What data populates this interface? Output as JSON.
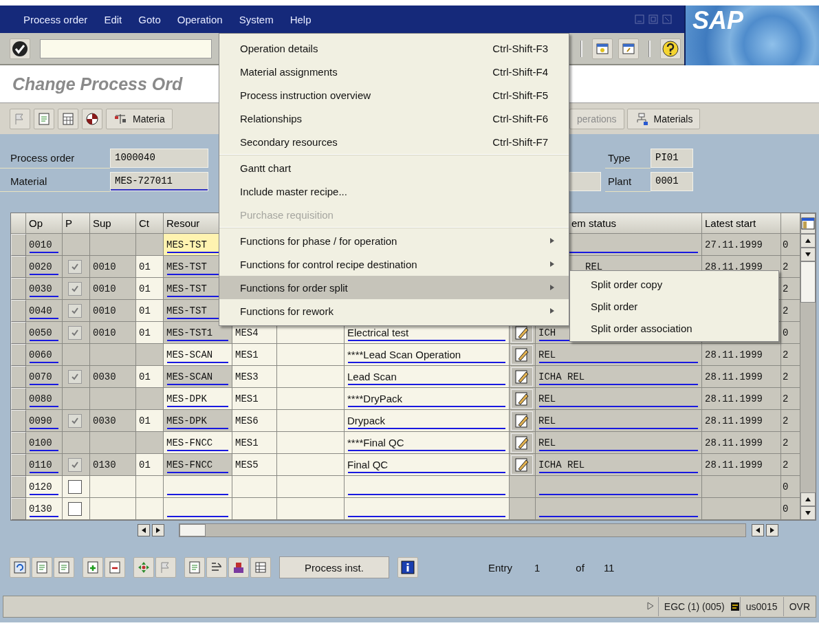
{
  "menu_bar": [
    {
      "label": "Process order"
    },
    {
      "label": "Edit"
    },
    {
      "label": "Goto"
    },
    {
      "label": "Operation"
    },
    {
      "label": "System"
    },
    {
      "label": "Help"
    }
  ],
  "logo": "SAP",
  "title": "Change Process Ord",
  "app_toolbar": [
    {
      "label": "Materia",
      "disabled": false
    },
    {
      "label": "perations",
      "disabled": true
    },
    {
      "label": "Materials",
      "disabled": false
    }
  ],
  "header": {
    "left": [
      {
        "label": "Process order",
        "value": "1000040"
      },
      {
        "label": "Material",
        "value": "MES-727011"
      }
    ],
    "right": [
      {
        "label": "Type",
        "value": "PI01"
      },
      {
        "label": "Plant",
        "value": "0001"
      }
    ]
  },
  "table": {
    "columns": [
      {
        "label": "Op"
      },
      {
        "label": "P"
      },
      {
        "label": "Sup"
      },
      {
        "label": "Ct"
      },
      {
        "label": "Resour"
      },
      {
        "label": "em status"
      },
      {
        "label": "Latest start"
      }
    ],
    "rows": [
      {
        "op": "0010",
        "locked": true,
        "focused": true,
        "resource": "MES-TST",
        "latest_start": "27.11.1999",
        "column_12": "0"
      },
      {
        "op": "0020",
        "locked": true,
        "focused": false,
        "checked": true,
        "disabled": true,
        "sup": "0010",
        "ct": "01",
        "resource": "MES-TST",
        "status": "REL",
        "latest_start": "28.11.1999",
        "column_12": "2"
      },
      {
        "op": "0030",
        "locked": true,
        "focused": false,
        "checked": true,
        "disabled": true,
        "sup": "0010",
        "ct": "01",
        "resource": "MES-TST",
        "column_12": "2"
      },
      {
        "op": "0040",
        "locked": true,
        "focused": false,
        "checked": true,
        "disabled": true,
        "sup": "0010",
        "ct": "01",
        "resource": "MES-TST",
        "column_12": "2"
      },
      {
        "op": "0050",
        "locked": true,
        "focused": false,
        "checked": true,
        "disabled": true,
        "sup": "0010",
        "ct": "01",
        "resource": "MES-TST1",
        "column_6": "MES4",
        "column_8": "Electrical test",
        "detail": true,
        "status": "ICH",
        "column_12": "0"
      },
      {
        "op": "0060",
        "locked": true,
        "focused": false,
        "resource": "MES-SCAN",
        "column_6": "MES1",
        "column_8": "****Lead Scan Operation",
        "detail": true,
        "status": "REL",
        "latest_start": "28.11.1999",
        "column_12": "2"
      },
      {
        "op": "0070",
        "locked": true,
        "focused": false,
        "checked": true,
        "disabled": true,
        "sup": "0030",
        "ct": "01",
        "resource": "MES-SCAN",
        "column_6": "MES3",
        "column_8": "Lead Scan",
        "detail": true,
        "status": "ICHA REL",
        "latest_start": "28.11.1999",
        "column_12": "2"
      },
      {
        "op": "0080",
        "locked": true,
        "focused": false,
        "resource": "MES-DPK",
        "column_6": "MES1",
        "column_8": "****DryPack",
        "detail": true,
        "status": "REL",
        "latest_start": "28.11.1999",
        "column_12": "2"
      },
      {
        "op": "0090",
        "locked": true,
        "focused": false,
        "checked": true,
        "disabled": true,
        "sup": "0030",
        "ct": "01",
        "resource": "MES-DPK",
        "column_6": "MES6",
        "column_8": "Drypack",
        "detail": true,
        "status": "REL",
        "latest_start": "28.11.1999",
        "column_12": "2"
      },
      {
        "op": "0100",
        "locked": true,
        "focused": false,
        "resource": "MES-FNCC",
        "column_6": "MES1",
        "column_8": "****Final QC",
        "detail": true,
        "status": "REL",
        "latest_start": "28.11.1999",
        "column_12": "2"
      },
      {
        "op": "0110",
        "locked": true,
        "focused": false,
        "checked": true,
        "disabled": true,
        "sup": "0130",
        "ct": "01",
        "resource": "MES-FNCC",
        "column_6": "MES5",
        "column_8": "Final QC",
        "detail": true,
        "status": "ICHA REL",
        "latest_start": "28.11.1999",
        "column_12": "2"
      },
      {
        "op": "0120",
        "locked": false,
        "focused": false,
        "checked": false,
        "disabled": false,
        "detail": false,
        "column_12": "0"
      },
      {
        "op": "0130",
        "locked": false,
        "focused": false,
        "checked": false,
        "disabled": false,
        "detail": false,
        "column_12": "0"
      }
    ]
  },
  "bottom_toolbar": {
    "button": "Process inst.",
    "entry_label": "Entry",
    "entry_current": "1",
    "entry_of": "of",
    "entry_total": "11"
  },
  "status_bar": {
    "system": "EGC (1) (005)",
    "client": "us0015",
    "mode": "OVR"
  },
  "operation_menu": {
    "items": [
      {
        "kind": "item",
        "label": "Operation details",
        "shortcut": "Ctrl-Shift-F3",
        "disabled": false,
        "selected": false
      },
      {
        "kind": "item",
        "label": "Material assignments",
        "shortcut": "Ctrl-Shift-F4",
        "disabled": false,
        "selected": false
      },
      {
        "kind": "item",
        "label": "Process instruction overview",
        "shortcut": "Ctrl-Shift-F5",
        "disabled": false,
        "selected": false
      },
      {
        "kind": "item",
        "label": "Relationships",
        "shortcut": "Ctrl-Shift-F6",
        "disabled": false,
        "selected": false
      },
      {
        "kind": "item",
        "label": "Secondary resources",
        "shortcut": "Ctrl-Shift-F7",
        "disabled": false,
        "selected": false
      },
      {
        "kind": "separator"
      },
      {
        "kind": "item",
        "label": "Gantt chart",
        "disabled": false,
        "selected": false
      },
      {
        "kind": "item",
        "label": "Include master recipe...",
        "disabled": false,
        "selected": false
      },
      {
        "kind": "item",
        "label": "Purchase requisition",
        "disabled": true,
        "selected": false
      },
      {
        "kind": "separator"
      },
      {
        "kind": "submenu",
        "label": "Functions for phase / for operation",
        "disabled": false,
        "selected": false
      },
      {
        "kind": "submenu",
        "label": "Functions for control recipe destination",
        "disabled": false,
        "selected": false
      },
      {
        "kind": "submenu",
        "label": "Functions for order split",
        "disabled": false,
        "selected": true
      },
      {
        "kind": "submenu",
        "label": "Functions for rework",
        "disabled": false,
        "selected": false
      }
    ],
    "submenu": [
      {
        "label": "Split order copy"
      },
      {
        "label": "Split order"
      },
      {
        "label": "Split order association"
      }
    ]
  }
}
